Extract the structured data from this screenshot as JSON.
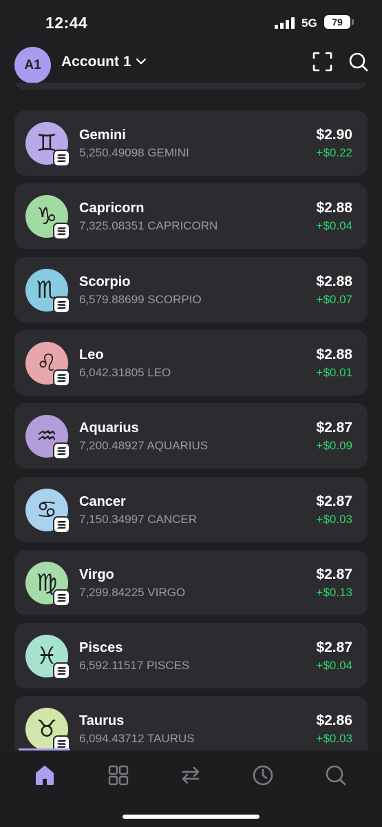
{
  "status_bar": {
    "time": "12:44",
    "network": "5G",
    "battery": "79"
  },
  "header": {
    "avatar_initials": "A1",
    "account_name": "Account 1",
    "icons": [
      "chevron-down-icon",
      "scan-icon",
      "search-icon"
    ]
  },
  "colors": {
    "background": "#1f1f21",
    "card": "#2c2c30",
    "accent": "#ab9ff2",
    "positive": "#2fd46b",
    "secondary_text": "#9a9aa0"
  },
  "tokens": [
    {
      "name": "Gemini",
      "balance": "5,250.49098 GEMINI",
      "value": "$2.90",
      "change": "+$0.22",
      "icon": "gemini-icon",
      "icon_bg": "#b9a8ea",
      "glyph": "♊"
    },
    {
      "name": "Capricorn",
      "balance": "7,325.08351 CAPRICORN",
      "value": "$2.88",
      "change": "+$0.04",
      "icon": "capricorn-icon",
      "icon_bg": "#a2dba2",
      "glyph": "♑"
    },
    {
      "name": "Scorpio",
      "balance": "6,579.88699 SCORPIO",
      "value": "$2.88",
      "change": "+$0.07",
      "icon": "scorpio-icon",
      "icon_bg": "#86cbe0",
      "glyph": "♏"
    },
    {
      "name": "Leo",
      "balance": "6,042.31805 LEO",
      "value": "$2.88",
      "change": "+$0.01",
      "icon": "leo-icon",
      "icon_bg": "#e6a6ab",
      "glyph": "♌"
    },
    {
      "name": "Aquarius",
      "balance": "7,200.48927 AQUARIUS",
      "value": "$2.87",
      "change": "+$0.09",
      "icon": "aquarius-icon",
      "icon_bg": "#b49bd9",
      "glyph": "♒"
    },
    {
      "name": "Cancer",
      "balance": "7,150.34997 CANCER",
      "value": "$2.87",
      "change": "+$0.03",
      "icon": "cancer-icon",
      "icon_bg": "#a9d2ef",
      "glyph": "♋"
    },
    {
      "name": "Virgo",
      "balance": "7,299.84225 VIRGO",
      "value": "$2.87",
      "change": "+$0.13",
      "icon": "virgo-icon",
      "icon_bg": "#a5dcaa",
      "glyph": "♍"
    },
    {
      "name": "Pisces",
      "balance": "6,592.11517 PISCES",
      "value": "$2.87",
      "change": "+$0.04",
      "icon": "pisces-icon",
      "icon_bg": "#a6e2cf",
      "glyph": "♓"
    },
    {
      "name": "Taurus",
      "balance": "6,094.43712 TAURUS",
      "value": "$2.86",
      "change": "+$0.03",
      "icon": "taurus-icon",
      "icon_bg": "#d2e6a9",
      "glyph": "♉"
    }
  ],
  "chain_badge_icon": "solana-icon",
  "tab_bar": {
    "tabs": [
      {
        "name": "tab-home",
        "icon": "home-icon",
        "active": true
      },
      {
        "name": "tab-collectibles",
        "icon": "grid-icon",
        "active": false
      },
      {
        "name": "tab-swap",
        "icon": "swap-icon",
        "active": false
      },
      {
        "name": "tab-activity",
        "icon": "clock-icon",
        "active": false
      },
      {
        "name": "tab-explore",
        "icon": "search-icon",
        "active": false
      }
    ]
  }
}
